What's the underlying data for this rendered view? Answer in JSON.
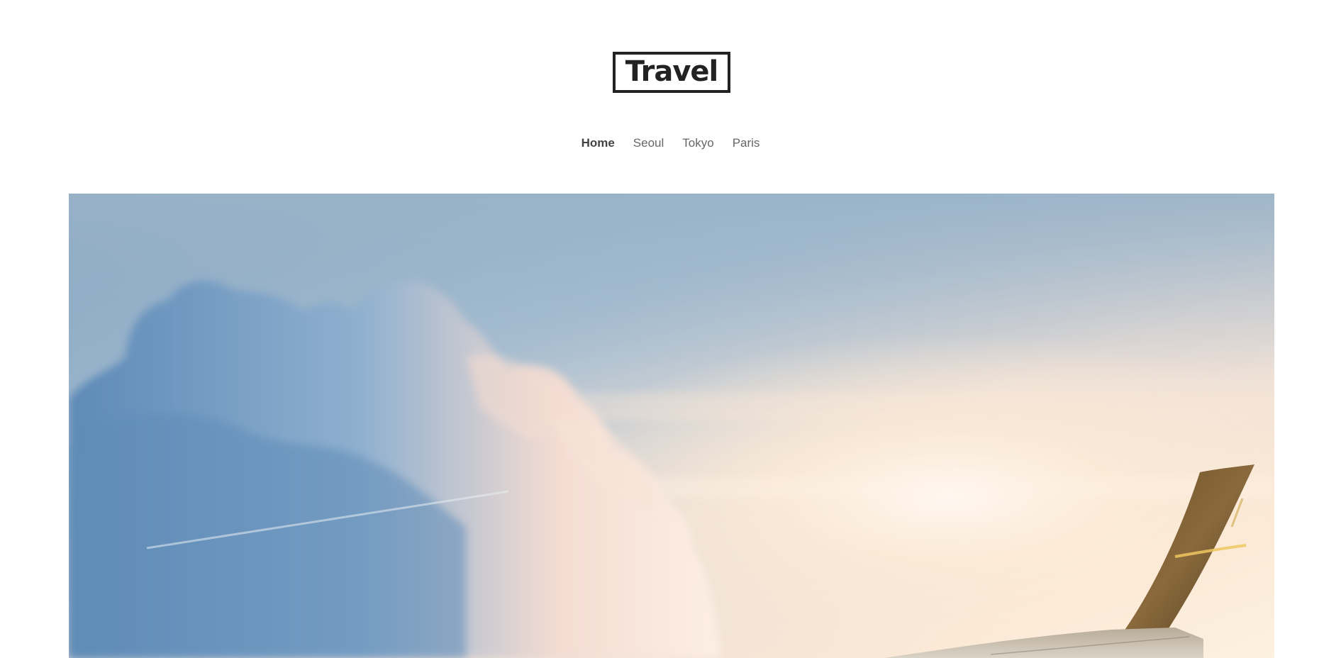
{
  "site": {
    "logo_text": "Travel"
  },
  "nav": {
    "items": [
      {
        "label": "Home",
        "active": true
      },
      {
        "label": "Seoul",
        "active": false
      },
      {
        "label": "Tokyo",
        "active": false
      },
      {
        "label": "Paris",
        "active": false
      }
    ]
  },
  "hero": {
    "image_subject": "sky-with-clouds-and-airplane-wing",
    "colors": {
      "sky_top": "#8fb0c9",
      "sky_warm": "#fbe7d2",
      "sun_glow": "#fff6ee",
      "cloud_shadow": "#6f98c0",
      "cloud_light": "#fbe4d6",
      "wing_dark": "#5a4322",
      "wing_light": "#9d8a6c"
    }
  }
}
